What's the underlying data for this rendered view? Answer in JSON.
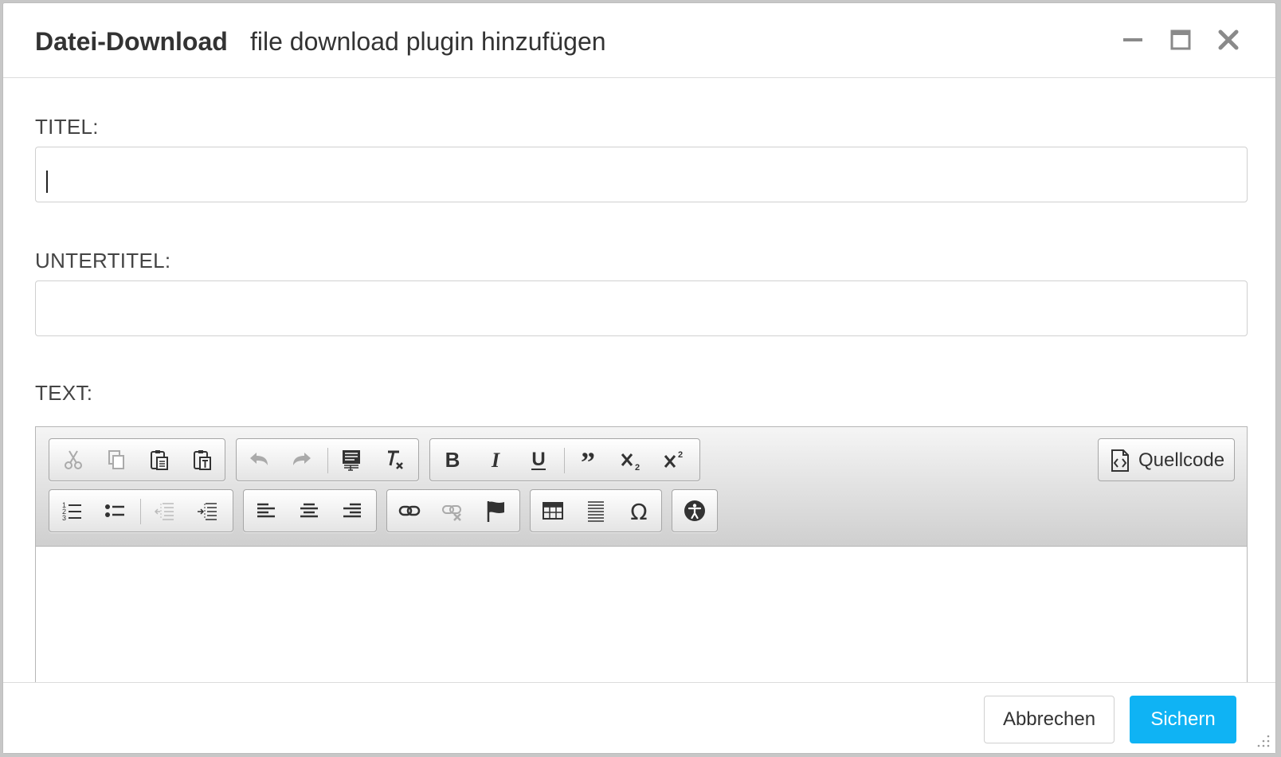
{
  "dialog": {
    "title": "Datei-Download",
    "subtitle": "file download plugin hinzufügen",
    "window_controls": [
      "minimize-icon",
      "maximize-icon",
      "close-icon"
    ]
  },
  "form": {
    "titel_label": "TITEL:",
    "titel_value": "",
    "untertitel_label": "UNTERTITEL:",
    "untertitel_value": "",
    "text_label": "TEXT:"
  },
  "editor": {
    "toolbar_row1": [
      {
        "group": "clipboard",
        "buttons": [
          "cut-icon",
          "copy-icon",
          "paste-icon",
          "paste-text-icon"
        ]
      },
      {
        "group": "history",
        "buttons": [
          "undo-icon",
          "redo-icon",
          "format-icon",
          "remove-format-icon"
        ]
      },
      {
        "group": "basicstyles",
        "buttons": [
          "bold-icon",
          "italic-icon",
          "underline-icon",
          "blockquote-icon",
          "subscript-icon",
          "superscript-icon"
        ]
      }
    ],
    "toolbar_row2": [
      {
        "group": "lists",
        "buttons": [
          "numbered-list-icon",
          "bulleted-list-icon",
          "outdent-icon",
          "indent-icon"
        ]
      },
      {
        "group": "align",
        "buttons": [
          "align-left-icon",
          "align-center-icon",
          "align-right-icon"
        ]
      },
      {
        "group": "links",
        "buttons": [
          "link-icon",
          "unlink-icon",
          "anchor-icon"
        ]
      },
      {
        "group": "insert",
        "buttons": [
          "table-icon",
          "horizontal-rule-icon",
          "special-char-icon"
        ]
      },
      {
        "group": "a11y",
        "buttons": [
          "accessibility-icon"
        ]
      }
    ],
    "source_label": "Quellcode",
    "content": ""
  },
  "footer": {
    "cancel_label": "Abbrechen",
    "save_label": "Sichern"
  },
  "colors": {
    "primary": "#0fb3f4",
    "text": "#333333",
    "border": "#d0d0d0"
  }
}
